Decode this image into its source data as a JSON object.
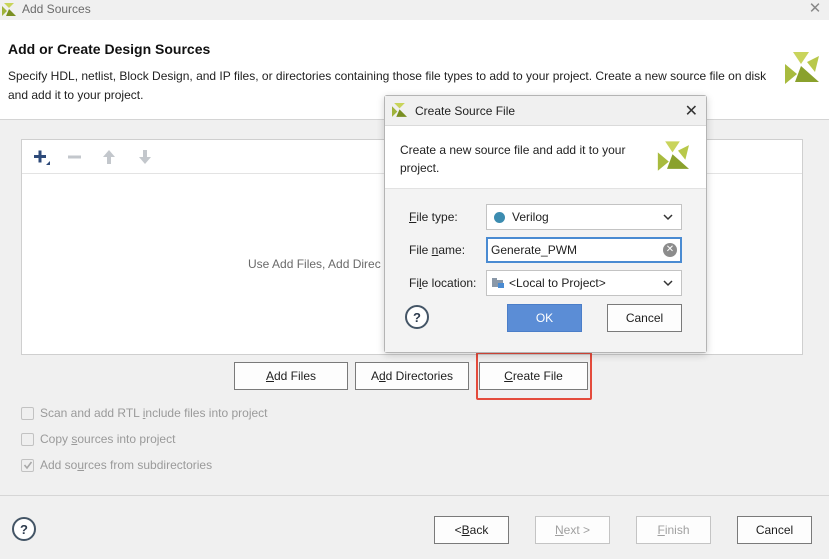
{
  "window": {
    "title": "Add Sources"
  },
  "header": {
    "heading": "Add or Create Design Sources",
    "description": "Specify HDL, netlist, Block Design, and IP files, or directories containing those file types to add to your project. Create a new source file on disk and add it to your project."
  },
  "file_panel": {
    "empty_message": "Use Add Files, Add Direc"
  },
  "actions": {
    "add_files": {
      "pre": "",
      "key": "A",
      "post": "dd Files"
    },
    "add_directories": {
      "pre": "A",
      "key": "d",
      "post": "d Directories"
    },
    "create_file": {
      "pre": "",
      "key": "C",
      "post": "reate File"
    }
  },
  "options": [
    {
      "pre": "Scan and add RTL ",
      "key": "i",
      "post": "nclude files into project",
      "checked": false
    },
    {
      "pre": "Copy ",
      "key": "s",
      "post": "ources into project",
      "checked": false
    },
    {
      "pre": "Add so",
      "key": "u",
      "post": "rces from subdirectories",
      "checked": true
    }
  ],
  "footer": {
    "help": "?",
    "back": {
      "pre": "< ",
      "key": "B",
      "post": "ack"
    },
    "next": {
      "pre": "",
      "key": "N",
      "post": "ext >"
    },
    "finish": {
      "pre": "",
      "key": "F",
      "post": "inish"
    },
    "cancel": "Cancel"
  },
  "dialog": {
    "title": "Create Source File",
    "description": "Create a new source file and add it to your project.",
    "file_type": {
      "pre": "",
      "key": "F",
      "post": "ile type:",
      "value": "Verilog"
    },
    "file_name": {
      "pre": "File ",
      "key": "n",
      "post": "ame:",
      "value": "Generate_PWM"
    },
    "file_location": {
      "pre": "Fi",
      "key": "l",
      "post": "e location:",
      "value": "<Local to Project>"
    },
    "help": "?",
    "ok": "OK",
    "cancel": "Cancel"
  },
  "colors": {
    "accent_blue": "#5b8dd6",
    "highlight_red": "#e44b3c",
    "verilog_dot": "#3c8cb0",
    "logo_green": "#a6b83a"
  }
}
